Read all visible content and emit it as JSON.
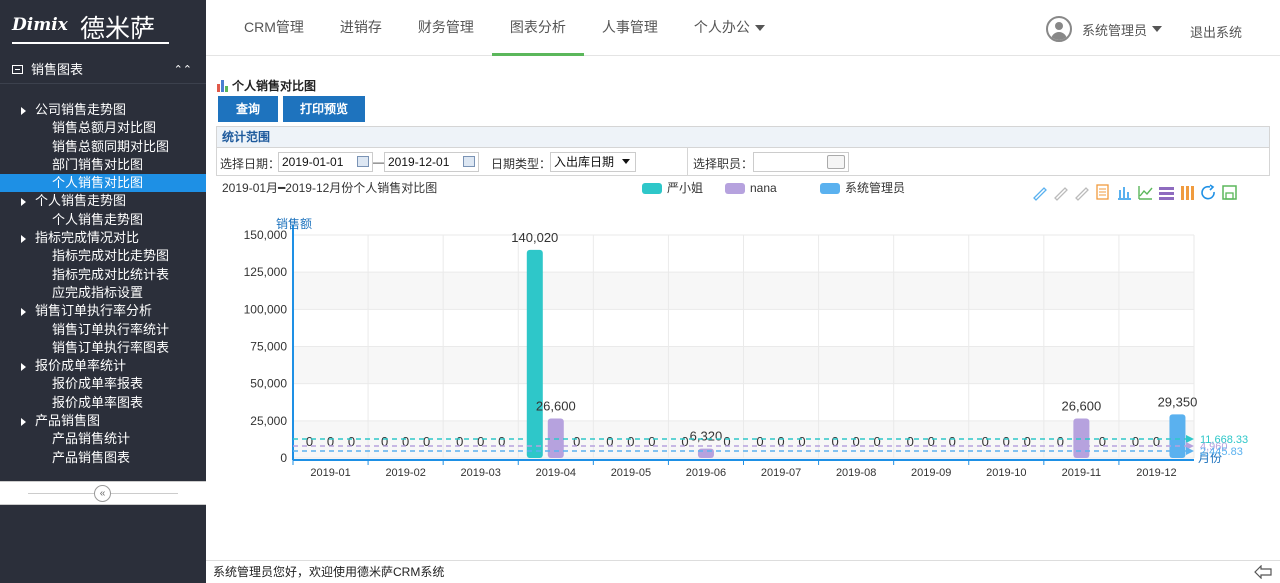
{
  "logo": {
    "en": "Dimix",
    "cn": "德米萨"
  },
  "nav": [
    {
      "label": "CRM管理",
      "has_dropdown": false,
      "active": false
    },
    {
      "label": "进销存",
      "has_dropdown": false,
      "active": false
    },
    {
      "label": "财务管理",
      "has_dropdown": false,
      "active": false
    },
    {
      "label": "图表分析",
      "has_dropdown": false,
      "active": true
    },
    {
      "label": "人事管理",
      "has_dropdown": false,
      "active": false
    },
    {
      "label": "个人办公",
      "has_dropdown": true,
      "active": false
    }
  ],
  "user": {
    "name": "系统管理员",
    "logout": "退出系统"
  },
  "sidebar": {
    "header": "销售图表",
    "groups": [
      {
        "label": "公司销售走势图",
        "items": [
          "销售总额月对比图",
          "销售总额同期对比图",
          "部门销售对比图",
          "个人销售对比图"
        ]
      },
      {
        "label": "个人销售走势图",
        "items": [
          "个人销售走势图"
        ]
      },
      {
        "label": "指标完成情况对比",
        "items": [
          "指标完成对比走势图",
          "指标完成对比统计表",
          "应完成指标设置"
        ]
      },
      {
        "label": "销售订单执行率分析",
        "items": [
          "销售订单执行率统计",
          "销售订单执行率图表"
        ]
      },
      {
        "label": "报价成单率统计",
        "items": [
          "报价成单率报表",
          "报价成单率图表"
        ]
      },
      {
        "label": "产品销售图",
        "items": [
          "产品销售统计",
          "产品销售图表"
        ]
      }
    ],
    "active_item": "个人销售对比图",
    "collapse_glyph": "«"
  },
  "page": {
    "title": "个人销售对比图",
    "query_button": "查询",
    "print_button": "打印预览",
    "filter_header": "统计范围",
    "date_label": "选择日期：",
    "date_from": "2019-01-01",
    "date_sep": "—",
    "date_to": "2019-12-01",
    "date_type_label": "日期类型：",
    "date_type_value": "入出库日期",
    "staff_label": "选择职员："
  },
  "status_bar": "系统管理员您好，欢迎使用德米萨CRM系统",
  "colors": {
    "series1": "#2ec7c9",
    "series2": "#b6a2de",
    "series3": "#5ab1ef",
    "accent": "#1e73be",
    "active_nav": "#5bb75b"
  },
  "toolbox_icons": [
    "mark-icon",
    "mark-undo-icon",
    "mark-clear-icon",
    "data-view-icon",
    "bar-type-icon",
    "line-type-icon",
    "stack-icon",
    "tiled-icon",
    "restore-icon",
    "save-image-icon"
  ],
  "chart_data": {
    "type": "bar",
    "title": "2019-01月━2019-12月份个人销售对比图",
    "ylabel": "销售额",
    "xlabel": "月份",
    "ylim": [
      0,
      150000
    ],
    "yticks": [
      0,
      25000,
      50000,
      75000,
      100000,
      125000,
      150000
    ],
    "ytick_labels": [
      "0",
      "25,000",
      "50,000",
      "75,000",
      "100,000",
      "125,000",
      "150,000"
    ],
    "categories": [
      "2019-01",
      "2019-02",
      "2019-03",
      "2019-04",
      "2019-05",
      "2019-06",
      "2019-07",
      "2019-08",
      "2019-09",
      "2019-10",
      "2019-11",
      "2019-12"
    ],
    "series": [
      {
        "name": "严小姐",
        "color": "#2ec7c9",
        "values": [
          0,
          0,
          0,
          140020,
          0,
          0,
          0,
          0,
          0,
          0,
          0,
          0
        ],
        "labels": [
          "0",
          "0",
          "0",
          "140,020",
          "0",
          "0",
          "0",
          "0",
          "0",
          "0",
          "0",
          "0"
        ]
      },
      {
        "name": "nana",
        "color": "#b6a2de",
        "values": [
          0,
          0,
          0,
          26600,
          0,
          6320,
          0,
          0,
          0,
          0,
          26600,
          0
        ],
        "labels": [
          "0",
          "0",
          "0",
          "26,600",
          "0",
          "6,320",
          "0",
          "0",
          "0",
          "0",
          "26,600",
          "0"
        ]
      },
      {
        "name": "系统管理员",
        "color": "#5ab1ef",
        "values": [
          0,
          0,
          0,
          0,
          0,
          0,
          0,
          0,
          0,
          0,
          0,
          29350
        ],
        "labels": [
          "0",
          "0",
          "0",
          "0",
          "0",
          "0",
          "0",
          "0",
          "0",
          "0",
          "0",
          "29,350"
        ]
      }
    ],
    "mark_lines": [
      {
        "series": "严小姐",
        "value": 11668.33,
        "label": "11,668.33",
        "color": "#2ec7c9"
      },
      {
        "series": "nana",
        "value": 4960,
        "label": "4,960",
        "color": "#b6a2de"
      },
      {
        "series": "系统管理员",
        "value": 2445.83,
        "label": "2,445.83",
        "color": "#5ab1ef"
      }
    ],
    "grid": true,
    "legend_position": "top-center"
  }
}
